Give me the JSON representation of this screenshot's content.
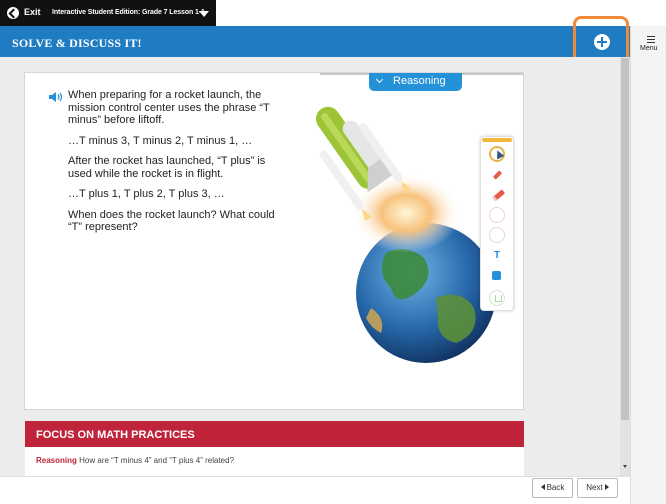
{
  "topbar": {
    "exit_label": "Exit",
    "edition_label": "Interactive Student Edition: Grade 7 Lesson 1-1"
  },
  "header": {
    "title": "SOLVE & DISCUSS IT!"
  },
  "menu": {
    "label": "Menu"
  },
  "card": {
    "reasoning_label": "Reasoning",
    "paragraphs": [
      "When preparing for a rocket launch, the mission control center uses the phrase “T minus” before liftoff.",
      "…T minus 3, T minus 2, T minus 1, …",
      "After the rocket has launched, “T plus” is used while the rocket is in flight.",
      "…T plus 1, T plus 2, T plus 3, …",
      "When does the rocket launch? What could “T” represent?"
    ]
  },
  "palette": {
    "tools": [
      "select-tool",
      "pen-tool",
      "highlighter-tool",
      "undo-tool",
      "redo-tool",
      "text-tool",
      "zoom-tool",
      "trash-tool"
    ],
    "text_tool_glyph": "T"
  },
  "focus": {
    "title": "FOCUS ON MATH PRACTICES",
    "keyword": "Reasoning",
    "question": "How are “T minus 4” and “T plus 4” related?"
  },
  "footer": {
    "back_label": "Back",
    "next_label": "Next"
  },
  "colors": {
    "header_blue": "#1f7bc2",
    "highlight_orange": "#ef8a3a",
    "focus_red": "#c0243a",
    "reasoning_blue": "#2591d9"
  }
}
